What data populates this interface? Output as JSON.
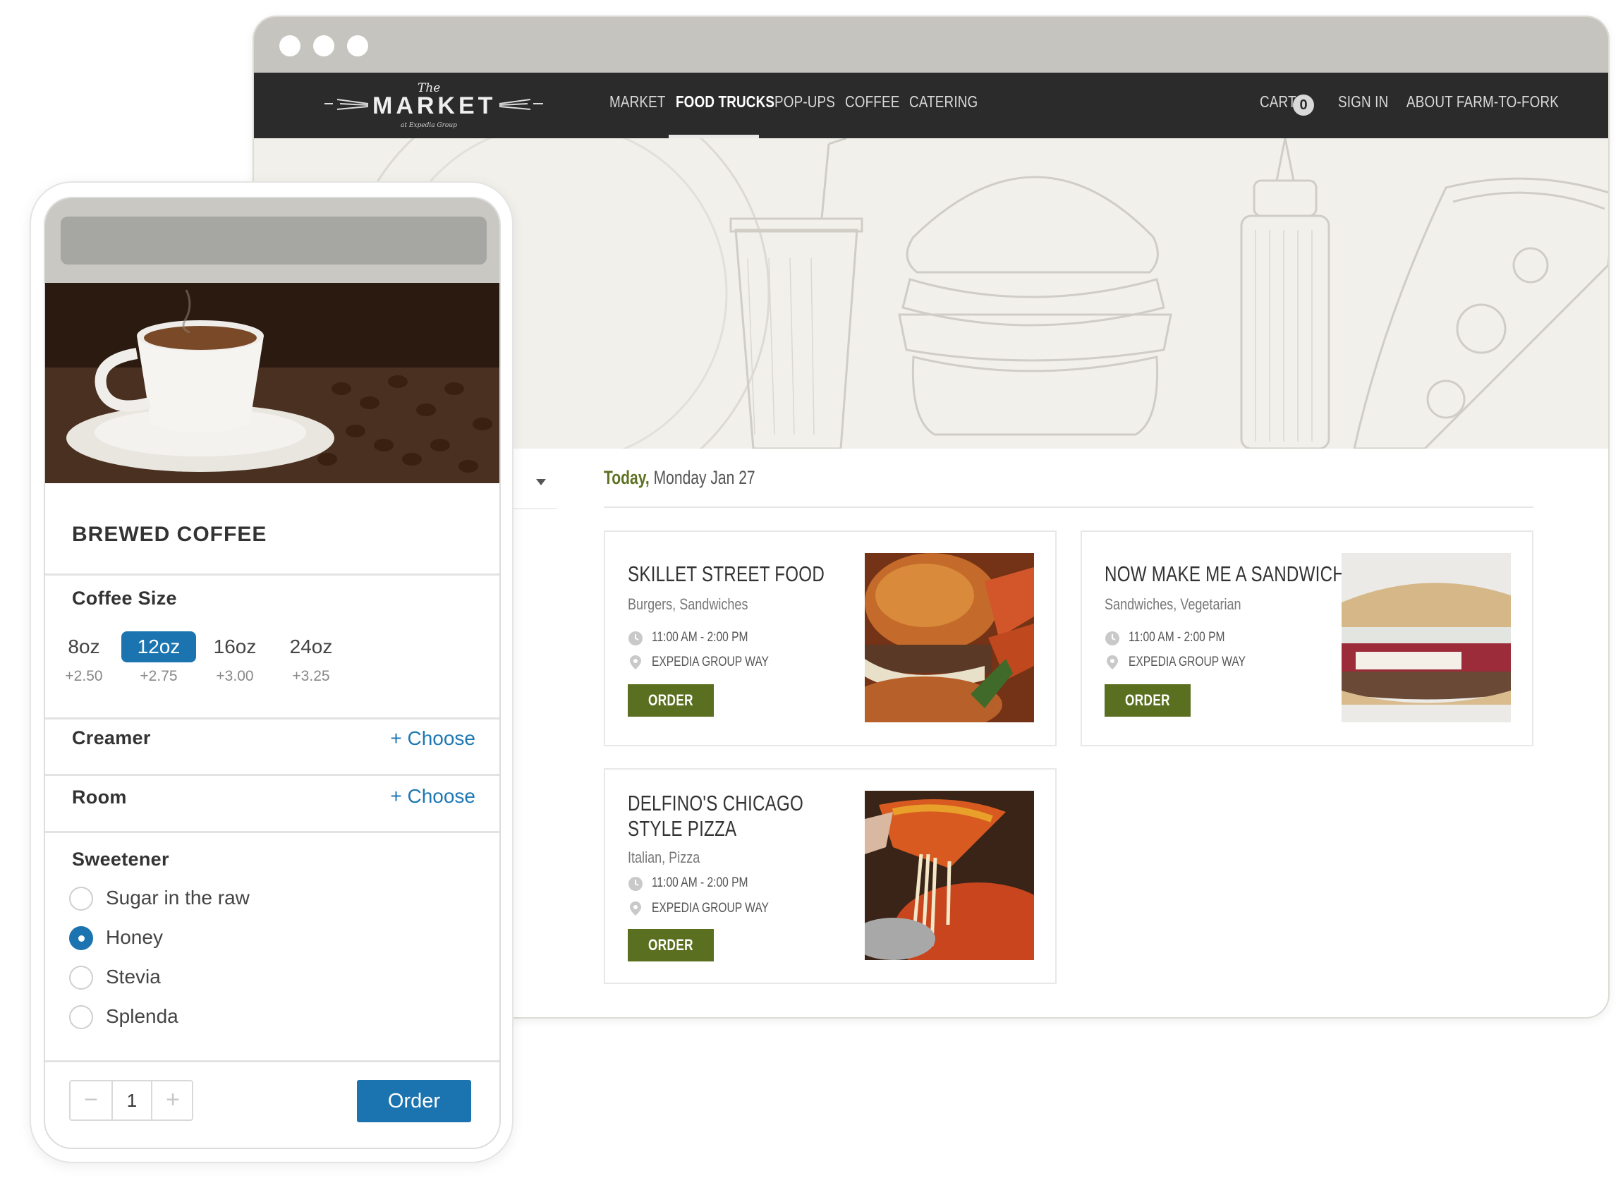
{
  "desktop": {
    "logo": {
      "the": "The",
      "name": "MARKET",
      "sub": "at Expedia Group"
    },
    "nav": {
      "market": "MARKET",
      "food_trucks": "FOOD TRUCKS",
      "pop_ups": "POP-UPS",
      "coffee": "COFFEE",
      "catering": "CATERING",
      "cart": "CART",
      "cart_count": "0",
      "sign_in": "SIGN IN",
      "about": "ABOUT FARM-TO-FORK"
    },
    "date": {
      "today": "Today,",
      "rest": "Monday Jan 27"
    },
    "trucks": [
      {
        "name_line1": "SKILLET STREET FOOD",
        "name_line2": "",
        "cuisine": "Burgers, Sandwiches",
        "hours": "11:00 AM - 2:00 PM",
        "location": "EXPEDIA GROUP WAY",
        "order": "ORDER"
      },
      {
        "name_line1": "NOW MAKE ME A SANDWICH",
        "name_line2": "",
        "cuisine": "Sandwiches, Vegetarian",
        "hours": "11:00 AM - 2:00 PM",
        "location": "EXPEDIA GROUP WAY",
        "order": "ORDER"
      },
      {
        "name_line1": "DELFINO'S CHICAGO",
        "name_line2": "STYLE PIZZA",
        "cuisine": "Italian, Pizza",
        "hours": "11:00 AM - 2:00 PM",
        "location": "EXPEDIA GROUP WAY",
        "order": "ORDER"
      }
    ]
  },
  "mobile": {
    "title": "BREWED COFFEE",
    "coffee_size_label": "Coffee Size",
    "sizes": [
      {
        "label": "8oz",
        "price": "+2.50"
      },
      {
        "label": "12oz",
        "price": "+2.75"
      },
      {
        "label": "16oz",
        "price": "+3.00"
      },
      {
        "label": "24oz",
        "price": "+3.25"
      }
    ],
    "selected_size": "12oz",
    "creamer_label": "Creamer",
    "room_label": "Room",
    "choose_label": "+ Choose",
    "sweetener_label": "Sweetener",
    "sweeteners": [
      "Sugar in the raw",
      "Honey",
      "Stevia",
      "Splenda"
    ],
    "selected_sweetener": "Honey",
    "quantity": "1",
    "minus": "−",
    "plus": "+",
    "order_label": "Order"
  },
  "colors": {
    "accent_blue": "#1b74b0",
    "accent_green": "#5a6f1f",
    "nav_bg": "#2b2b2b",
    "hero_bg": "#f2f0eb"
  },
  "icons": [
    "clock-icon",
    "location-pin-icon",
    "dropdown-caret-icon"
  ]
}
